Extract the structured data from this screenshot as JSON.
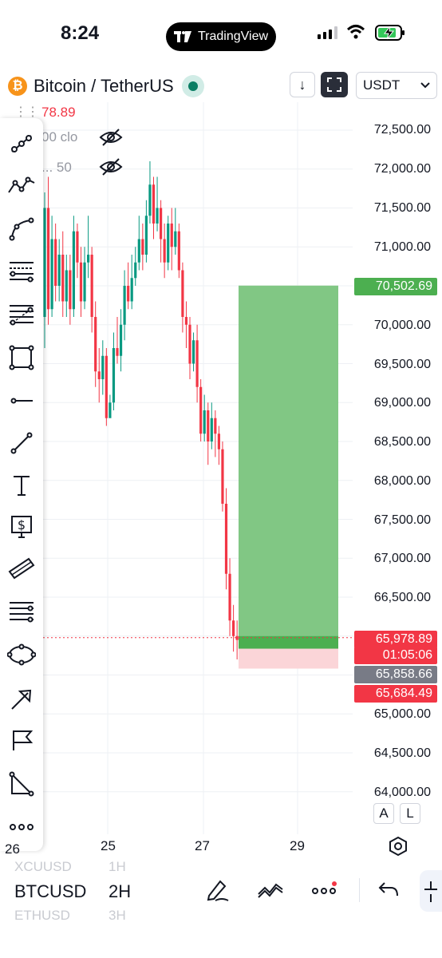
{
  "status_bar": {
    "time": "8:24",
    "app_pill": "TradingView"
  },
  "header": {
    "symbol_title": "Bitcoin / TetherUS",
    "currency": "USDT",
    "down_arrow": "↓"
  },
  "legend": {
    "price_fragment": "78.89",
    "indicator1_fragment": "00 clo",
    "indicator2_fragment": "...   50"
  },
  "price_axis": {
    "labels": [
      "72,500.00",
      "72,000.00",
      "71,500.00",
      "71,000.00",
      "70,000.00",
      "69,500.00",
      "69,000.00",
      "68,500.00",
      "68,000.00",
      "67,500.00",
      "67,000.00",
      "66,500.00",
      "65,000.00",
      "64,500.00",
      "64,000.00"
    ],
    "target_tag": "70,502.69",
    "last_price_tag": "65,978.89",
    "countdown_tag": "01:05:06",
    "entry_tag": "65,858.66",
    "stop_tag": "65,684.49"
  },
  "time_axis": {
    "labels": [
      "25",
      "27",
      "29"
    ],
    "partial_left": "26"
  },
  "scale_buttons": {
    "auto": "A",
    "log": "L"
  },
  "bottom": {
    "symbol": "BTCUSD",
    "interval": "2H",
    "prev_symbol": "XCUUSD",
    "prev_interval": "1H",
    "next_symbol": "ETHUSD",
    "next_interval": "3H"
  },
  "colors": {
    "up": "#089981",
    "down": "#f23645",
    "target_zone": "#81c784",
    "stop_zone": "#fbd5d8",
    "tag_green": "#4caf50",
    "tag_grey": "#787b86"
  },
  "chart_data": {
    "type": "candlestick",
    "position_tool": {
      "target": 70502.69,
      "entry": 65858.66,
      "stop": 65684.49,
      "last": 65978.89
    },
    "ylim": [
      63900,
      73000
    ]
  }
}
